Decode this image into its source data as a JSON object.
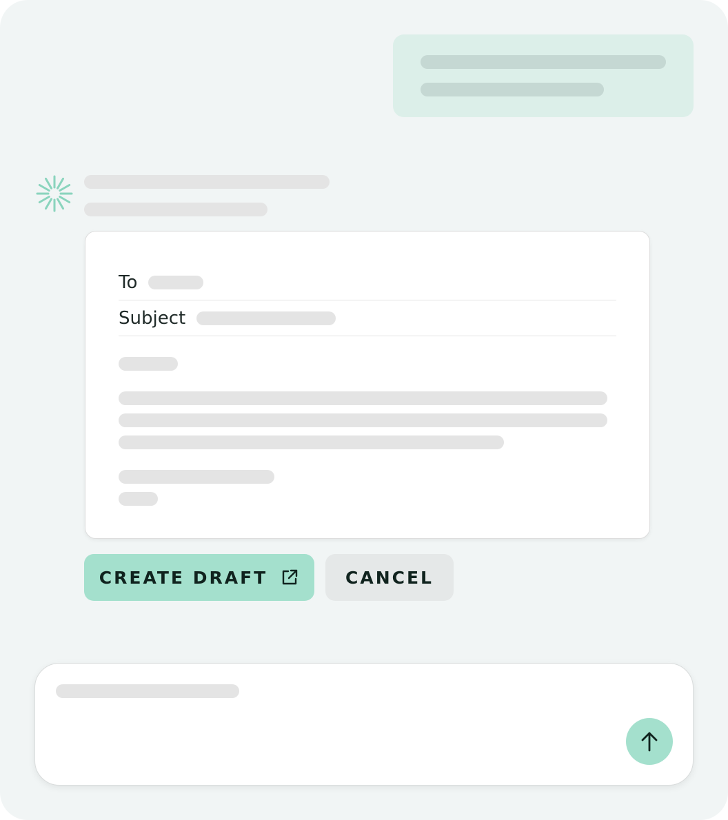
{
  "email": {
    "to_label": "To",
    "subject_label": "Subject"
  },
  "actions": {
    "create_draft_label": "CREATE DRAFT",
    "cancel_label": "CANCEL"
  },
  "icons": {
    "assistant": "sparkle-burst-icon",
    "create_draft": "external-link-icon",
    "send": "arrow-up-icon"
  },
  "colors": {
    "accent": "#a4e0cd",
    "user_bubble": "#dcefe9",
    "background": "#f1f5f5",
    "placeholder": "#e4e4e4"
  }
}
